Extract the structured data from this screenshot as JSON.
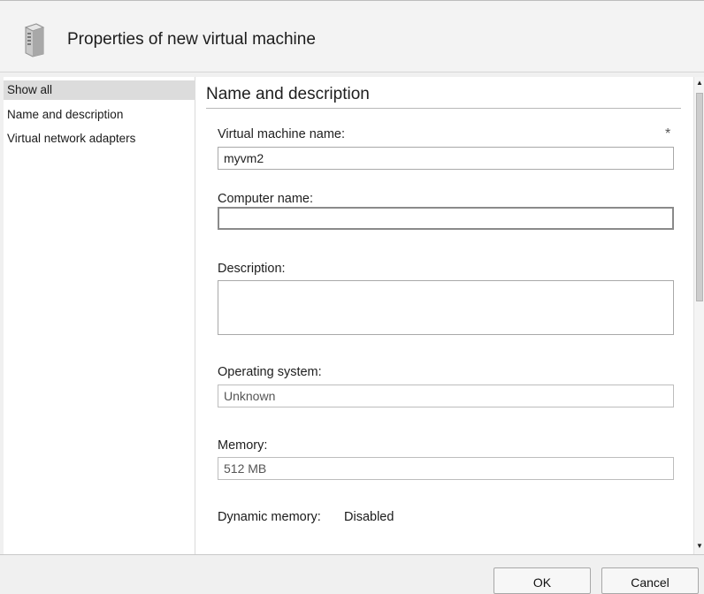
{
  "window": {
    "title": "Properties of new virtual machine",
    "icon": "server-tower-icon"
  },
  "nav": {
    "items": [
      {
        "label": "Show all",
        "selected": true
      },
      {
        "label": "Name and description",
        "selected": false
      },
      {
        "label": "Virtual network adapters",
        "selected": false
      }
    ]
  },
  "section": {
    "title": "Name and description"
  },
  "form": {
    "vm_name": {
      "label": "Virtual machine name:",
      "value": "myvm2",
      "required_marker": "*"
    },
    "computer_name": {
      "label": "Computer name:",
      "value": ""
    },
    "description": {
      "label": "Description:",
      "value": ""
    },
    "operating_system": {
      "label": "Operating system:",
      "value": "Unknown"
    },
    "memory": {
      "label": "Memory:",
      "value": "512 MB"
    },
    "dynamic_memory": {
      "label": "Dynamic memory:",
      "value": "Disabled"
    }
  },
  "footer": {
    "ok_label": "OK",
    "cancel_label": "Cancel"
  },
  "scrollbar": {
    "up_icon": "scroll-up-arrow-icon",
    "down_icon": "scroll-down-arrow-icon"
  }
}
